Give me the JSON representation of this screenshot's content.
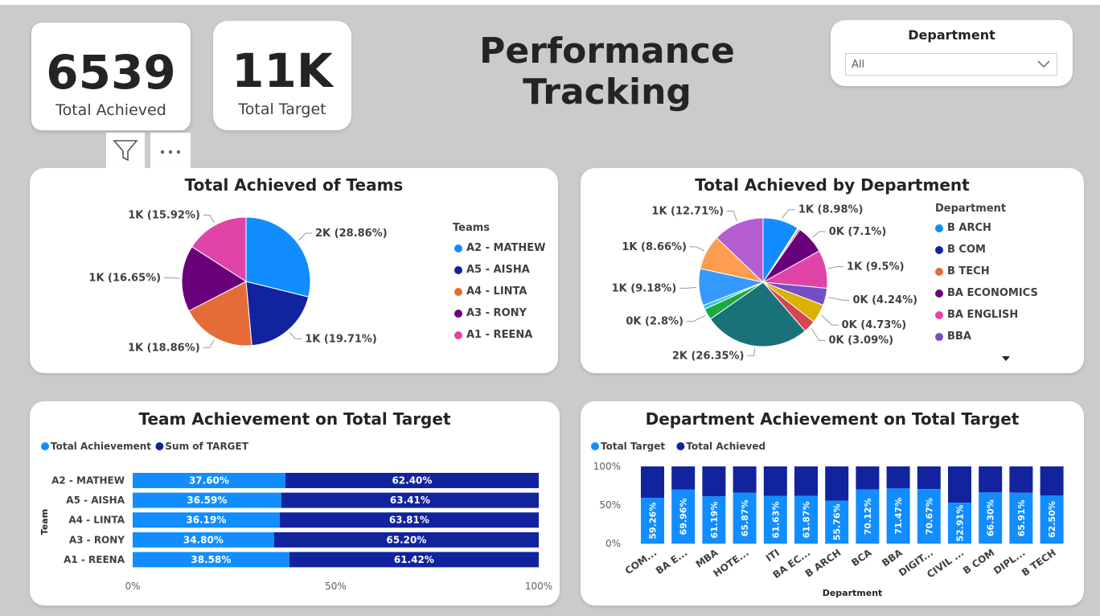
{
  "header": {
    "title": "Performance Tracking"
  },
  "kpis": [
    {
      "value": "6539",
      "label": "Total Achieved"
    },
    {
      "value": "11K",
      "label": "Total Target"
    }
  ],
  "filter": {
    "title": "Department",
    "value": "All"
  },
  "colors": {
    "light_blue": "#118dff",
    "dark_blue": "#12239e",
    "orange": "#e66c37",
    "purple": "#6b007b",
    "pink": "#e044a7",
    "violet": "#744ec2",
    "yellow": "#d9b300",
    "red": "#d64550",
    "teal": "#197278",
    "light_teal": "#1aab40",
    "peach": "#fd9d4f",
    "lilac": "#b55ed0",
    "sky": "#3599ff"
  },
  "chart_data": [
    {
      "id": "teams_pie",
      "type": "pie",
      "title": "Total Achieved of Teams",
      "legend_title": "Teams",
      "legend_position": "right",
      "slices": [
        {
          "name": "A2 - MATHEW",
          "value": 28.86,
          "label": "2K (28.86%)",
          "color": "#118dff"
        },
        {
          "name": "A5 - AISHA",
          "value": 19.71,
          "label": "1K (19.71%)",
          "color": "#12239e"
        },
        {
          "name": "A4 - LINTA",
          "value": 18.86,
          "label": "1K (18.86%)",
          "color": "#e66c37"
        },
        {
          "name": "A3 - RONY",
          "value": 16.65,
          "label": "1K (16.65%)",
          "color": "#6b007b"
        },
        {
          "name": "A1 - REENA",
          "value": 15.92,
          "label": "1K (15.92%)",
          "color": "#e044a7"
        }
      ]
    },
    {
      "id": "dept_pie",
      "type": "pie",
      "title": "Total Achieved by Department",
      "legend_title": "Department",
      "legend_position": "right",
      "legend_entries": [
        {
          "name": "B ARCH",
          "color": "#118dff"
        },
        {
          "name": "B COM",
          "color": "#12239e"
        },
        {
          "name": "B TECH",
          "color": "#e66c37"
        },
        {
          "name": "BA ECONOMICS",
          "color": "#6b007b"
        },
        {
          "name": "BA ENGLISH",
          "color": "#e044a7"
        },
        {
          "name": "BBA",
          "color": "#744ec2"
        }
      ],
      "slices": [
        {
          "value": 8.98,
          "label": "1K (8.98%)",
          "color": "#118dff"
        },
        {
          "value": 0.2,
          "label": "",
          "color": "#12239e"
        },
        {
          "value": 0.45,
          "label": "",
          "color": "#e66c37"
        },
        {
          "value": 7.1,
          "label": "0K (7.1%)",
          "color": "#6b007b"
        },
        {
          "value": 9.5,
          "label": "1K (9.5%)",
          "color": "#e044a7"
        },
        {
          "value": 4.24,
          "label": "0K (4.24%)",
          "color": "#744ec2"
        },
        {
          "value": 4.73,
          "label": "0K (4.73%)",
          "color": "#d9b300"
        },
        {
          "value": 3.09,
          "label": "0K (3.09%)",
          "color": "#d64550"
        },
        {
          "value": 26.35,
          "label": "2K (26.35%)",
          "color": "#197278"
        },
        {
          "value": 2.8,
          "label": "0K (2.8%)",
          "color": "#1aab40"
        },
        {
          "value": 1.0,
          "label": "",
          "color": "#33c6e0"
        },
        {
          "value": 9.18,
          "label": "1K (9.18%)",
          "color": "#3599ff"
        },
        {
          "value": 8.66,
          "label": "1K (8.66%)",
          "color": "#fd9d4f"
        },
        {
          "value": 12.71,
          "label": "1K (12.71%)",
          "color": "#b55ed0"
        }
      ]
    },
    {
      "id": "team_bars",
      "type": "bar",
      "orientation": "horizontal",
      "stacked": "100%",
      "title": "Team Achievement on Total Target",
      "ylabel": "Team",
      "legend_position": "top-left",
      "categories": [
        "A2 - MATHEW",
        "A5 - AISHA",
        "A4 - LINTA",
        "A3 - RONY",
        "A1 - REENA"
      ],
      "series": [
        {
          "name": "Total Achievement",
          "color": "#118dff",
          "values": [
            37.6,
            36.59,
            36.19,
            34.8,
            38.58
          ],
          "labels": [
            "37.60%",
            "36.59%",
            "36.19%",
            "34.80%",
            "38.58%"
          ]
        },
        {
          "name": "Sum of TARGET",
          "color": "#12239e",
          "values": [
            62.4,
            63.41,
            63.81,
            65.2,
            61.42
          ],
          "labels": [
            "62.40%",
            "63.41%",
            "63.81%",
            "65.20%",
            "61.42%"
          ]
        }
      ],
      "xticks": [
        "0%",
        "50%",
        "100%"
      ]
    },
    {
      "id": "dept_bars",
      "type": "bar",
      "orientation": "vertical",
      "stacked": "100%",
      "title": "Department Achievement on Total Target",
      "xlabel": "Department",
      "legend_position": "top-left",
      "categories": [
        "COM...",
        "BA E...",
        "MBA",
        "HOTE...",
        "ITI",
        "BA EC...",
        "B ARCH",
        "BCA",
        "BBA",
        "DIGIT...",
        "CIVIL ...",
        "B COM",
        "DIPL...",
        "B TECH"
      ],
      "series": [
        {
          "name": "Total Target",
          "color": "#118dff",
          "values": [
            59.26,
            69.96,
            61.19,
            65.87,
            61.63,
            61.87,
            55.76,
            70.12,
            71.47,
            70.67,
            52.91,
            66.3,
            65.91,
            62.5
          ],
          "labels": [
            "59.26%",
            "69.96%",
            "61.19%",
            "65.87%",
            "61.63%",
            "61.87%",
            "55.76%",
            "70.12%",
            "71.47%",
            "70.67%",
            "52.91%",
            "66.30%",
            "65.91%",
            "62.50%"
          ]
        },
        {
          "name": "Total Achieved",
          "color": "#12239e"
        }
      ],
      "yticks": [
        "100%",
        "50%",
        "0%"
      ]
    }
  ]
}
